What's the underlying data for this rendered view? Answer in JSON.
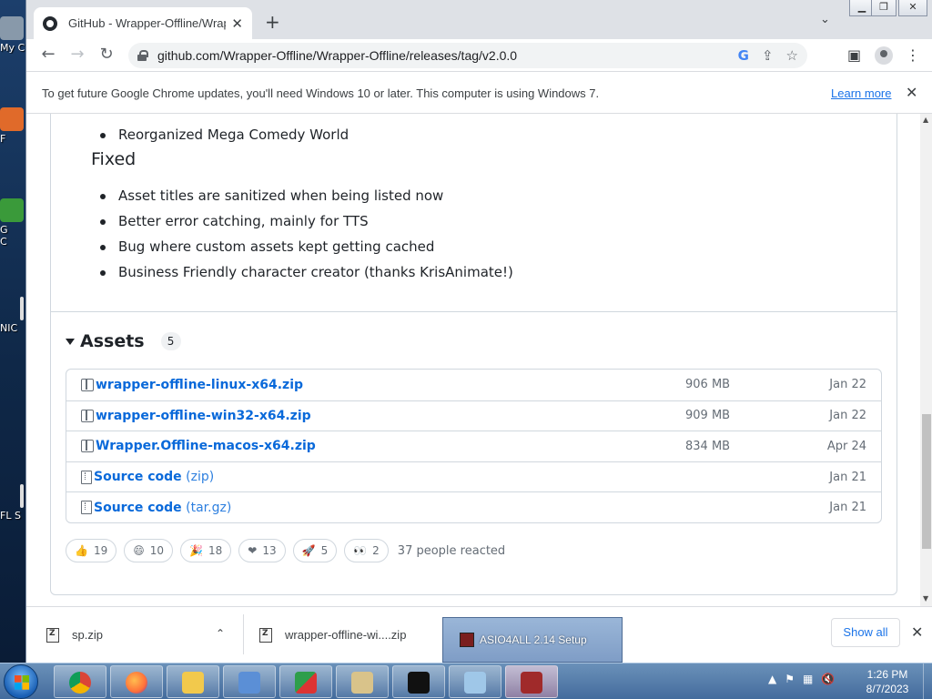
{
  "browser": {
    "tab_title": "GitHub - Wrapper-Offline/Wrapper",
    "tab_close": "✕",
    "new_tab": "+",
    "tab_menu": "⌄",
    "url": "github.com/Wrapper-Offline/Wrapper-Offline/releases/tag/v2.0.0",
    "infobar_message": "To get future Google Chrome updates, you'll need Windows 10 or later. This computer is using Windows 7.",
    "infobar_link": "Learn more",
    "infobar_close": "✕"
  },
  "desktop_icons": [
    {
      "label": "My C",
      "color": "#8899aa"
    },
    {
      "label": "F",
      "color": "#e06a2a"
    },
    {
      "label": "G",
      "color": "#3a9a3a"
    },
    {
      "label": "C",
      "color": "#3a9a3a"
    },
    {
      "label": "NIC",
      "color": "#dddddd"
    },
    {
      "label": "FL S",
      "color": "#dddddd"
    }
  ],
  "release": {
    "cut_off_line": "...",
    "top_bullets": [
      "Reorganized Mega Comedy World"
    ],
    "fixed_heading": "Fixed",
    "fixed_bullets": [
      "Asset titles are sanitized when being listed now",
      "Better error catching, mainly for TTS",
      "Bug where custom assets kept getting cached",
      "Business Friendly character creator (thanks KrisAnimate!)"
    ],
    "assets_heading": "Assets",
    "assets_count": "5",
    "assets": [
      {
        "name": "wrapper-offline-linux-x64.zip",
        "suffix": "",
        "size": "906 MB",
        "date": "Jan 22",
        "icon": "package-icon"
      },
      {
        "name": "wrapper-offline-win32-x64.zip",
        "suffix": "",
        "size": "909 MB",
        "date": "Jan 22",
        "icon": "package-icon"
      },
      {
        "name": "Wrapper.Offline-macos-x64.zip",
        "suffix": "",
        "size": "834 MB",
        "date": "Apr 24",
        "icon": "package-icon"
      },
      {
        "name": "Source code",
        "suffix": "(zip)",
        "size": "",
        "date": "Jan 21",
        "icon": "file-zip-icon"
      },
      {
        "name": "Source code",
        "suffix": "(tar.gz)",
        "size": "",
        "date": "Jan 21",
        "icon": "file-zip-icon"
      }
    ],
    "reactions": [
      {
        "emoji": "👍",
        "count": "19",
        "name": "thumbs-up-reaction"
      },
      {
        "emoji": "😄",
        "count": "10",
        "name": "laugh-reaction"
      },
      {
        "emoji": "🎉",
        "count": "18",
        "name": "hooray-reaction"
      },
      {
        "emoji": "❤",
        "count": "13",
        "name": "heart-reaction"
      },
      {
        "emoji": "🚀",
        "count": "5",
        "name": "rocket-reaction"
      },
      {
        "emoji": "👀",
        "count": "2",
        "name": "eyes-reaction"
      }
    ],
    "reactions_summary": "37 people reacted"
  },
  "downloads": {
    "items": [
      {
        "name": "sp.zip"
      },
      {
        "name": "wrapper-offline-wi....zip"
      }
    ],
    "show_all": "Show all",
    "close": "✕"
  },
  "taskbar": {
    "preview_label": "ASIO4ALL 2.14 Setup",
    "apps": [
      {
        "name": "chrome-task",
        "color": "#db4437"
      },
      {
        "name": "firefox-task",
        "color": "#ff7139"
      },
      {
        "name": "explorer-task",
        "color": "#f2c94c"
      },
      {
        "name": "control-panel-task",
        "color": "#5b8fd6"
      },
      {
        "name": "app-3d-task",
        "color": "#2e9e4b"
      },
      {
        "name": "installer-task",
        "color": "#d9c38a"
      },
      {
        "name": "cmd-task",
        "color": "#111111"
      },
      {
        "name": "notepad-task",
        "color": "#9fc7e8"
      },
      {
        "name": "asio4all-task",
        "color": "#a02a2a"
      }
    ],
    "time": "1:26 PM",
    "date": "8/7/2023"
  }
}
